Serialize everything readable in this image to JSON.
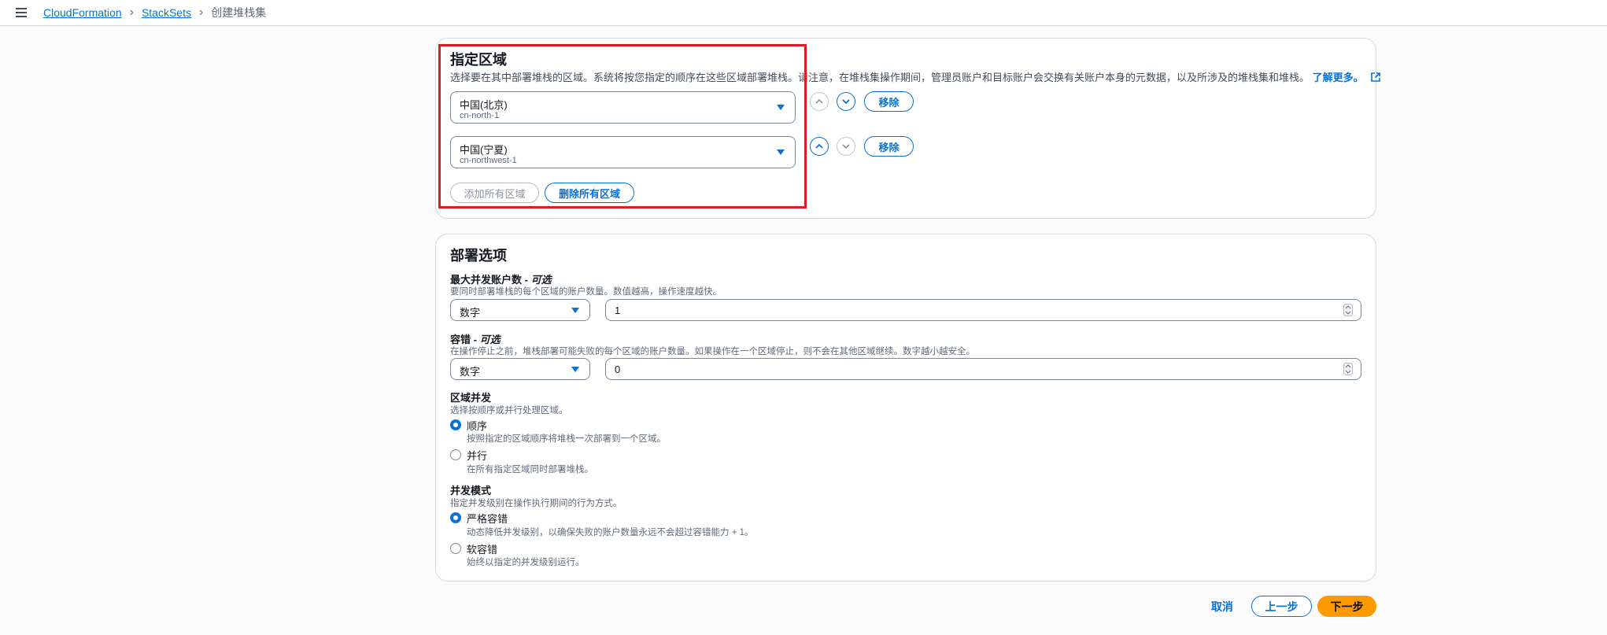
{
  "breadcrumb": {
    "items": [
      "CloudFormation",
      "StackSets"
    ],
    "current": "创建堆栈集"
  },
  "regions_section": {
    "title": "指定区域",
    "description": "选择要在其中部署堆栈的区域。系统将按您指定的顺序在这些区域部署堆栈。请注意，在堆栈集操作期间，管理员账户和目标账户会交换有关账户本身的元数据，以及所涉及的堆栈集和堆栈。",
    "learn_more": "了解更多。",
    "regions": [
      {
        "name": "中国(北京)",
        "code": "cn-north-1",
        "remove": "移除"
      },
      {
        "name": "中国(宁夏)",
        "code": "cn-northwest-1",
        "remove": "移除"
      }
    ],
    "add_all": "添加所有区域",
    "remove_all": "删除所有区域"
  },
  "deployment": {
    "title": "部署选项",
    "max_concurrent": {
      "label": "最大并发账户数 - ",
      "optional": "可选",
      "help": "要同时部署堆栈的每个区域的账户数量。数值越高，操作速度越快。",
      "type": "数字",
      "value": "1"
    },
    "failure_tolerance": {
      "label": "容错 - ",
      "optional": "可选",
      "help": "在操作停止之前，堆栈部署可能失败的每个区域的账户数量。如果操作在一个区域停止，则不会在其他区域继续。数字越小越安全。",
      "type": "数字",
      "value": "0"
    },
    "region_concurrency": {
      "label": "区域并发",
      "help": "选择按顺序或并行处理区域。",
      "options": [
        {
          "label": "顺序",
          "help": "按照指定的区域顺序将堆栈一次部署到一个区域。",
          "checked": true
        },
        {
          "label": "并行",
          "help": "在所有指定区域同时部署堆栈。",
          "checked": false
        }
      ]
    },
    "concurrency_mode": {
      "label": "并发模式",
      "help": "指定并发级别在操作执行期间的行为方式。",
      "options": [
        {
          "label": "严格容错",
          "help": "动态降低并发级别，以确保失败的账户数量永远不会超过容错能力 + 1。",
          "checked": true
        },
        {
          "label": "软容错",
          "help": "始终以指定的并发级别运行。",
          "checked": false
        }
      ]
    }
  },
  "footer": {
    "cancel": "取消",
    "previous": "上一步",
    "next": "下一步"
  },
  "colors": {
    "accent": "#0972d3",
    "primary_button": "#ff9900",
    "highlight_border": "#e01a24"
  }
}
